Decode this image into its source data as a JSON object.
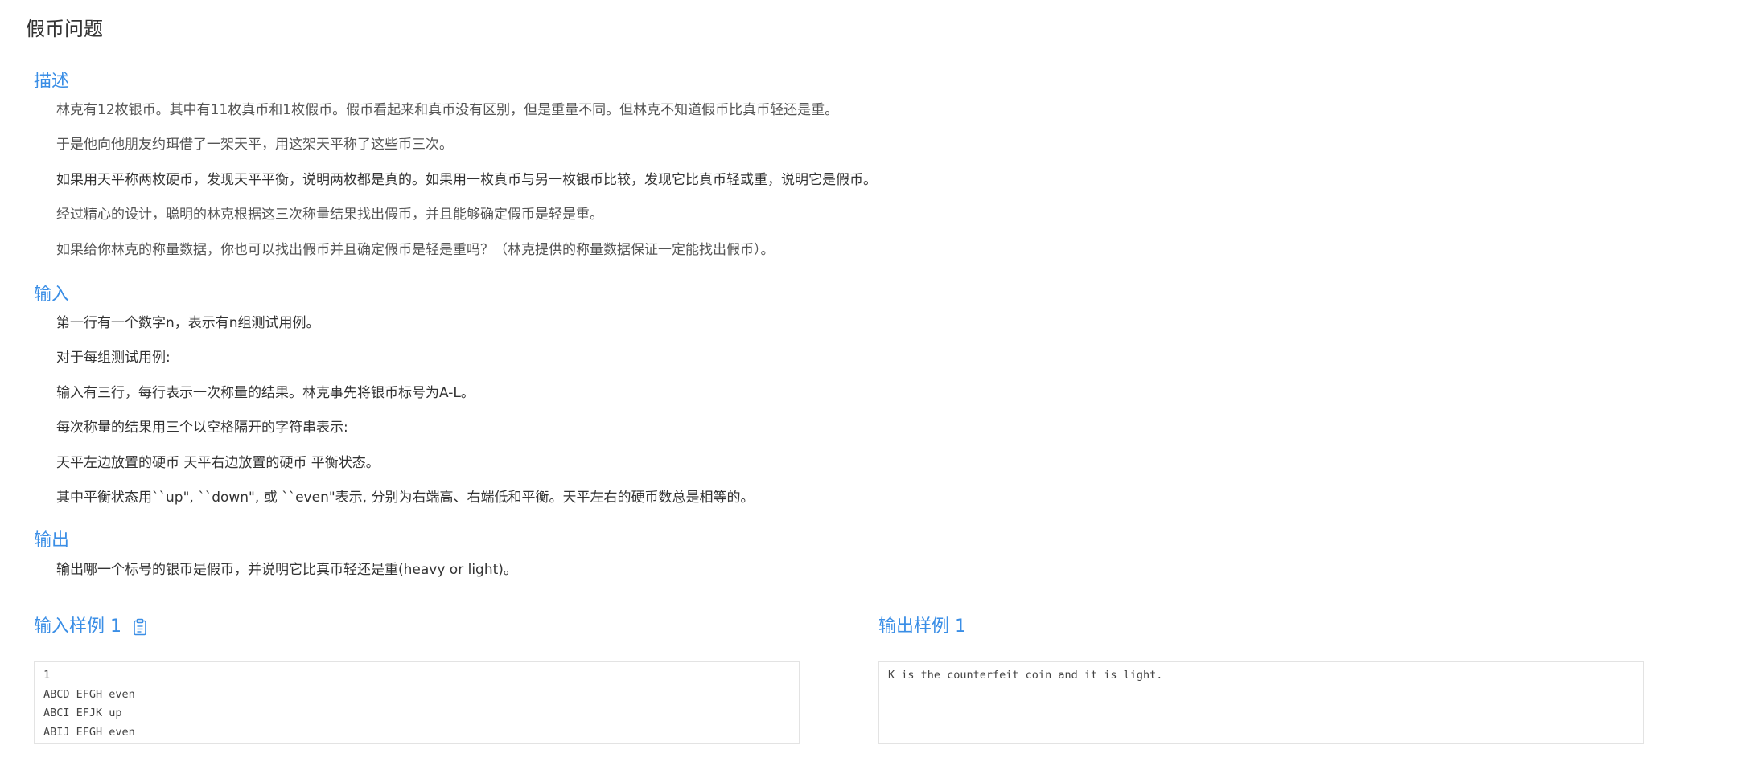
{
  "page": {
    "title": "假币问题"
  },
  "description": {
    "heading": "描述",
    "paragraphs": [
      "林克有12枚银币。其中有11枚真币和1枚假币。假币看起来和真币没有区别，但是重量不同。但林克不知道假币比真币轻还是重。",
      "于是他向他朋友约珥借了一架天平，用这架天平称了这些币三次。",
      "如果用天平称两枚硬币，发现天平平衡，说明两枚都是真的。如果用一枚真币与另一枚银币比较，发现它比真币轻或重，说明它是假币。",
      "经过精心的设计，聪明的林克根据这三次称量结果找出假币，并且能够确定假币是轻是重。",
      "如果给你林克的称量数据，你也可以找出假币并且确定假币是轻是重吗？（林克提供的称量数据保证一定能找出假币）。"
    ]
  },
  "input": {
    "heading": "输入",
    "paragraphs": [
      "第一行有一个数字n，表示有n组测试用例。",
      "对于每组测试用例:",
      "输入有三行，每行表示一次称量的结果。林克事先将银币标号为A-L。",
      "每次称量的结果用三个以空格隔开的字符串表示:",
      "天平左边放置的硬币  天平右边放置的硬币  平衡状态。",
      "其中平衡状态用``up\", ``down\", 或 ``even\"表示, 分别为右端高、右端低和平衡。天平左右的硬币数总是相等的。"
    ]
  },
  "output": {
    "heading": "输出",
    "paragraphs": [
      "输出哪一个标号的银币是假币，并说明它比真币轻还是重(heavy or light)。"
    ]
  },
  "samples": {
    "input_heading": "输入样例 1",
    "output_heading": "输出样例 1",
    "copy_icon": "clipboard-icon",
    "input_lines": [
      "1",
      "ABCD EFGH even",
      "ABCI EFJK up",
      "ABIJ EFGH even"
    ],
    "output_lines": [
      "K is the counterfeit coin and it is light."
    ]
  },
  "colors": {
    "accent": "#3a8ee6",
    "text": "#333333",
    "border": "#e3e3e3"
  }
}
